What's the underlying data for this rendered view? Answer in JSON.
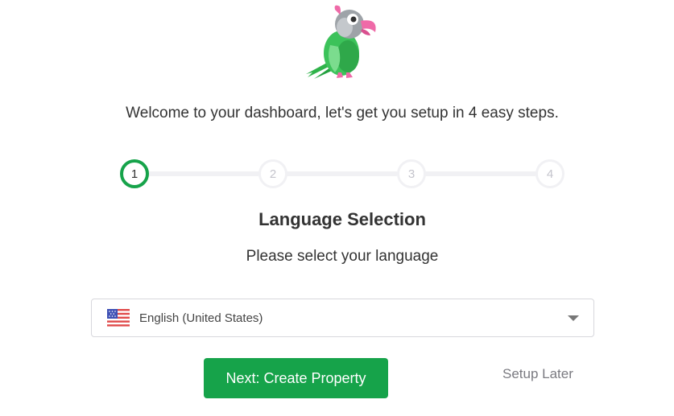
{
  "header": {
    "logo_icon": "parrot-mascot-icon",
    "welcome_text": "Welcome to your dashboard, let's get you setup in 4 easy steps."
  },
  "stepper": {
    "current_step": 1,
    "steps": [
      {
        "label": "1"
      },
      {
        "label": "2"
      },
      {
        "label": "3"
      },
      {
        "label": "4"
      }
    ],
    "active_color": "#16a34a",
    "inactive_color": "#f1f1f4"
  },
  "section": {
    "title": "Language Selection",
    "subtitle": "Please select your language"
  },
  "language_select": {
    "selected_value": "English (United States)",
    "flag_icon": "us-flag-icon",
    "caret_icon": "chevron-down-icon"
  },
  "actions": {
    "next_label": "Next: Create Property",
    "later_label": "Setup Later",
    "primary_color": "#16a34a"
  }
}
